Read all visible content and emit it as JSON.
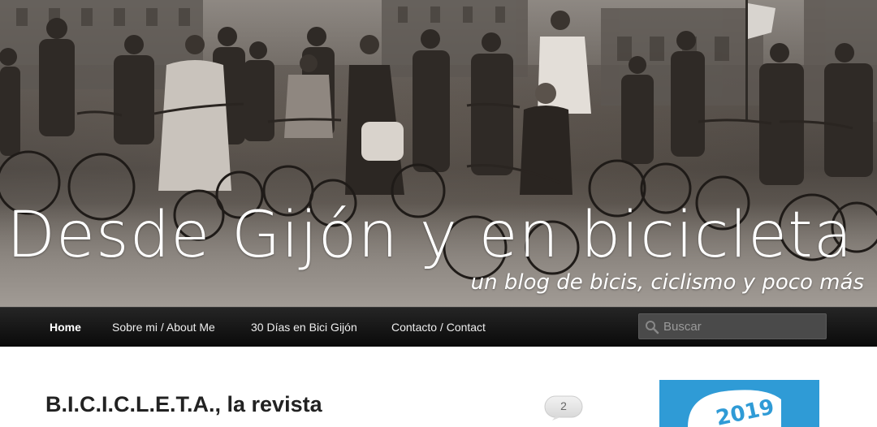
{
  "header": {
    "site_title": "Desde Gijón y en bicicleta",
    "tagline": "un blog de bicis, ciclismo y poco más"
  },
  "nav": {
    "items": [
      {
        "label": "Home",
        "active": true
      },
      {
        "label": "Sobre mi / About Me",
        "active": false
      },
      {
        "label": "30 Días en Bici Gijón",
        "active": false
      },
      {
        "label": "Contacto / Contact",
        "active": false
      }
    ],
    "search": {
      "placeholder": "Buscar",
      "icon": "search-icon"
    }
  },
  "post": {
    "title": "B.I.C.I.C.L.E.T.A., la revista",
    "comment_count": "2"
  },
  "sidebar": {
    "widget_text": "2019",
    "widget_color": "#2f9bd6"
  },
  "colors": {
    "navbar": "#111111",
    "nav_text": "#eeeeee",
    "title_text": "#222222"
  }
}
